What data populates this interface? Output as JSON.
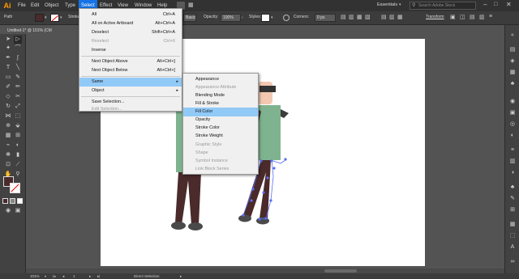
{
  "app": {
    "logo": "Ai"
  },
  "menubar": {
    "items": [
      "File",
      "Edit",
      "Object",
      "Type",
      "Select",
      "Effect",
      "View",
      "Window",
      "Help"
    ],
    "workspace": "Essentials",
    "search_placeholder": "Search Adobe Stock"
  },
  "controlbar": {
    "path_label": "Path",
    "stroke_label": "Stroke",
    "style_basic": "Basic",
    "opacity_label": "Opacity:",
    "opacity_value": "100%",
    "styles_label": "Styles:",
    "corners_label": "Corners:",
    "corners_value": "0 px",
    "transform_label": "Transform",
    "fill_color": "#4a2a2a"
  },
  "document": {
    "tab_label": "Untitled-1* @ 101% (CM"
  },
  "select_menu": {
    "items": [
      {
        "label": "All",
        "shortcut": "Ctrl+A",
        "disabled": false
      },
      {
        "label": "All on Active Artboard",
        "shortcut": "Alt+Ctrl+A",
        "disabled": false
      },
      {
        "label": "Deselect",
        "shortcut": "Shift+Ctrl+A",
        "disabled": false
      },
      {
        "label": "Reselect",
        "shortcut": "Ctrl+6",
        "disabled": true
      },
      {
        "label": "Inverse",
        "shortcut": "",
        "disabled": false
      },
      {
        "label": "Next Object Above",
        "shortcut": "Alt+Ctrl+]",
        "disabled": false
      },
      {
        "label": "Next Object Below",
        "shortcut": "Alt+Ctrl+[",
        "disabled": false
      },
      {
        "label": "Same",
        "shortcut": "",
        "disabled": false
      },
      {
        "label": "Object",
        "shortcut": "",
        "disabled": false
      },
      {
        "label": "Save Selection...",
        "shortcut": "",
        "disabled": false
      },
      {
        "label": "Edit Selection...",
        "shortcut": "",
        "disabled": true
      }
    ]
  },
  "same_submenu": {
    "items": [
      {
        "label": "Appearance",
        "disabled": false
      },
      {
        "label": "Appearance Attribute",
        "disabled": true
      },
      {
        "label": "Blending Mode",
        "disabled": false
      },
      {
        "label": "Fill & Stroke",
        "disabled": false
      },
      {
        "label": "Fill Color",
        "disabled": false
      },
      {
        "label": "Opacity",
        "disabled": false
      },
      {
        "label": "Stroke Color",
        "disabled": false
      },
      {
        "label": "Stroke Weight",
        "disabled": false
      },
      {
        "label": "Graphic Style",
        "disabled": true
      },
      {
        "label": "Shape",
        "disabled": true
      },
      {
        "label": "Symbol Instance",
        "disabled": true
      },
      {
        "label": "Link Block Series",
        "disabled": true
      }
    ],
    "highlighted": "Fill Color"
  },
  "statusbar": {
    "zoom": "101%",
    "artboard_number": "1",
    "tool_name": "Direct Selection"
  },
  "colors": {
    "accent": "#1473e6",
    "menu_highlight": "#91c9f7",
    "skin": "#f2c9b0",
    "shirt": "#7fb38f",
    "pants": "#4a2a2a",
    "shoes": "#4a4a4a",
    "sleeve": "#3c3c3c"
  }
}
